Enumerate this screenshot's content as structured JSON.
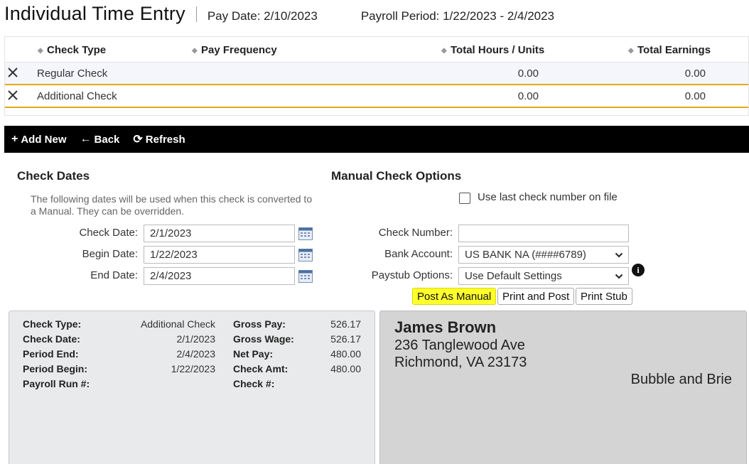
{
  "header": {
    "title": "Individual Time Entry",
    "pay_date": "Pay Date: 2/10/2023",
    "payroll_period": "Payroll Period: 1/22/2023 - 2/4/2023"
  },
  "grid": {
    "columns": {
      "check_type": "Check Type",
      "pay_frequency": "Pay Frequency",
      "total_hours": "Total Hours / Units",
      "total_earnings": "Total Earnings"
    },
    "rows": [
      {
        "check_type": "Regular Check",
        "pay_frequency": "",
        "total_hours": "0.00",
        "total_earnings": "0.00"
      },
      {
        "check_type": "Additional Check",
        "pay_frequency": "",
        "total_hours": "0.00",
        "total_earnings": "0.00"
      }
    ]
  },
  "toolbar": {
    "add_new": "Add New",
    "back": "Back",
    "refresh": "Refresh"
  },
  "check_dates": {
    "title": "Check Dates",
    "note": "The following dates will be used when this check is converted to a Manual. They can be overridden.",
    "check_date_label": "Check Date:",
    "check_date_value": "2/1/2023",
    "begin_date_label": "Begin Date:",
    "begin_date_value": "1/22/2023",
    "end_date_label": "End Date:",
    "end_date_value": "2/4/2023"
  },
  "manual_options": {
    "title": "Manual Check Options",
    "use_last_check_label": "Use last check number on file",
    "use_last_check_checked": false,
    "check_number_label": "Check Number:",
    "check_number_value": "",
    "bank_account_label": "Bank Account:",
    "bank_account_value": "US BANK NA (####6789)",
    "paystub_options_label": "Paystub Options:",
    "paystub_options_value": "Use Default Settings",
    "post_as_manual": "Post As Manual",
    "print_and_post": "Print and Post",
    "print_stub": "Print Stub"
  },
  "summary": {
    "check_type_label": "Check Type:",
    "check_type_value": "Additional Check",
    "check_date_label": "Check Date:",
    "check_date_value": "2/1/2023",
    "period_end_label": "Period End:",
    "period_end_value": "2/4/2023",
    "period_begin_label": "Period Begin:",
    "period_begin_value": "1/22/2023",
    "payroll_run_label": "Payroll Run #:",
    "payroll_run_value": "",
    "gross_pay_label": "Gross Pay:",
    "gross_pay_value": "526.17",
    "gross_wage_label": "Gross Wage:",
    "gross_wage_value": "526.17",
    "net_pay_label": "Net Pay:",
    "net_pay_value": "480.00",
    "check_amt_label": "Check Amt:",
    "check_amt_value": "480.00",
    "check_num_label": "Check #:",
    "check_num_value": ""
  },
  "stub_preview": {
    "employee_name": "James Brown",
    "address_line1": "236 Tanglewood Ave",
    "address_line2": "Richmond, VA 23173",
    "company": "Bubble and Brie"
  },
  "colors": {
    "toolbar_bg": "#000000",
    "row_highlight_border": "#e6a817",
    "post_button_bg": "#ffff2e"
  }
}
